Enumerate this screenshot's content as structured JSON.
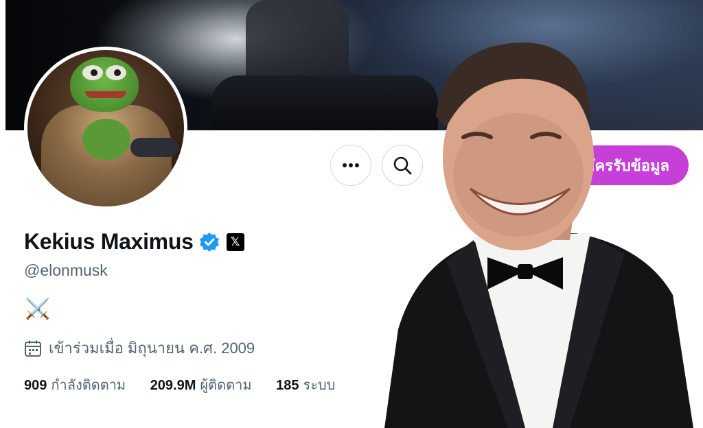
{
  "header": {
    "banner_description_icon": "space-banner",
    "more_icon": "more-icon",
    "search_icon": "search-icon",
    "subscribe_label": "สมัครรับข้อมูล"
  },
  "profile": {
    "display_name": "Kekius Maximus",
    "handle": "@elonmusk",
    "bio": "⚔️",
    "joined_icon": "calendar-icon",
    "joined": "เข้าร่วมเมื่อ มิถุนายน ค.ศ. 2009",
    "verified_icon": "verified-badge-icon",
    "affiliate_badge": "𝕏"
  },
  "stats": [
    {
      "value": "909",
      "label": "กำลังติดตาม"
    },
    {
      "value": "209.9M",
      "label": "ผู้ติดตาม"
    },
    {
      "value": "185",
      "label": "ระบบ"
    }
  ],
  "colors": {
    "accent": "#c63fd8",
    "verified": "#1d9bf0",
    "text_primary": "#0f1419",
    "text_secondary": "#536471"
  }
}
